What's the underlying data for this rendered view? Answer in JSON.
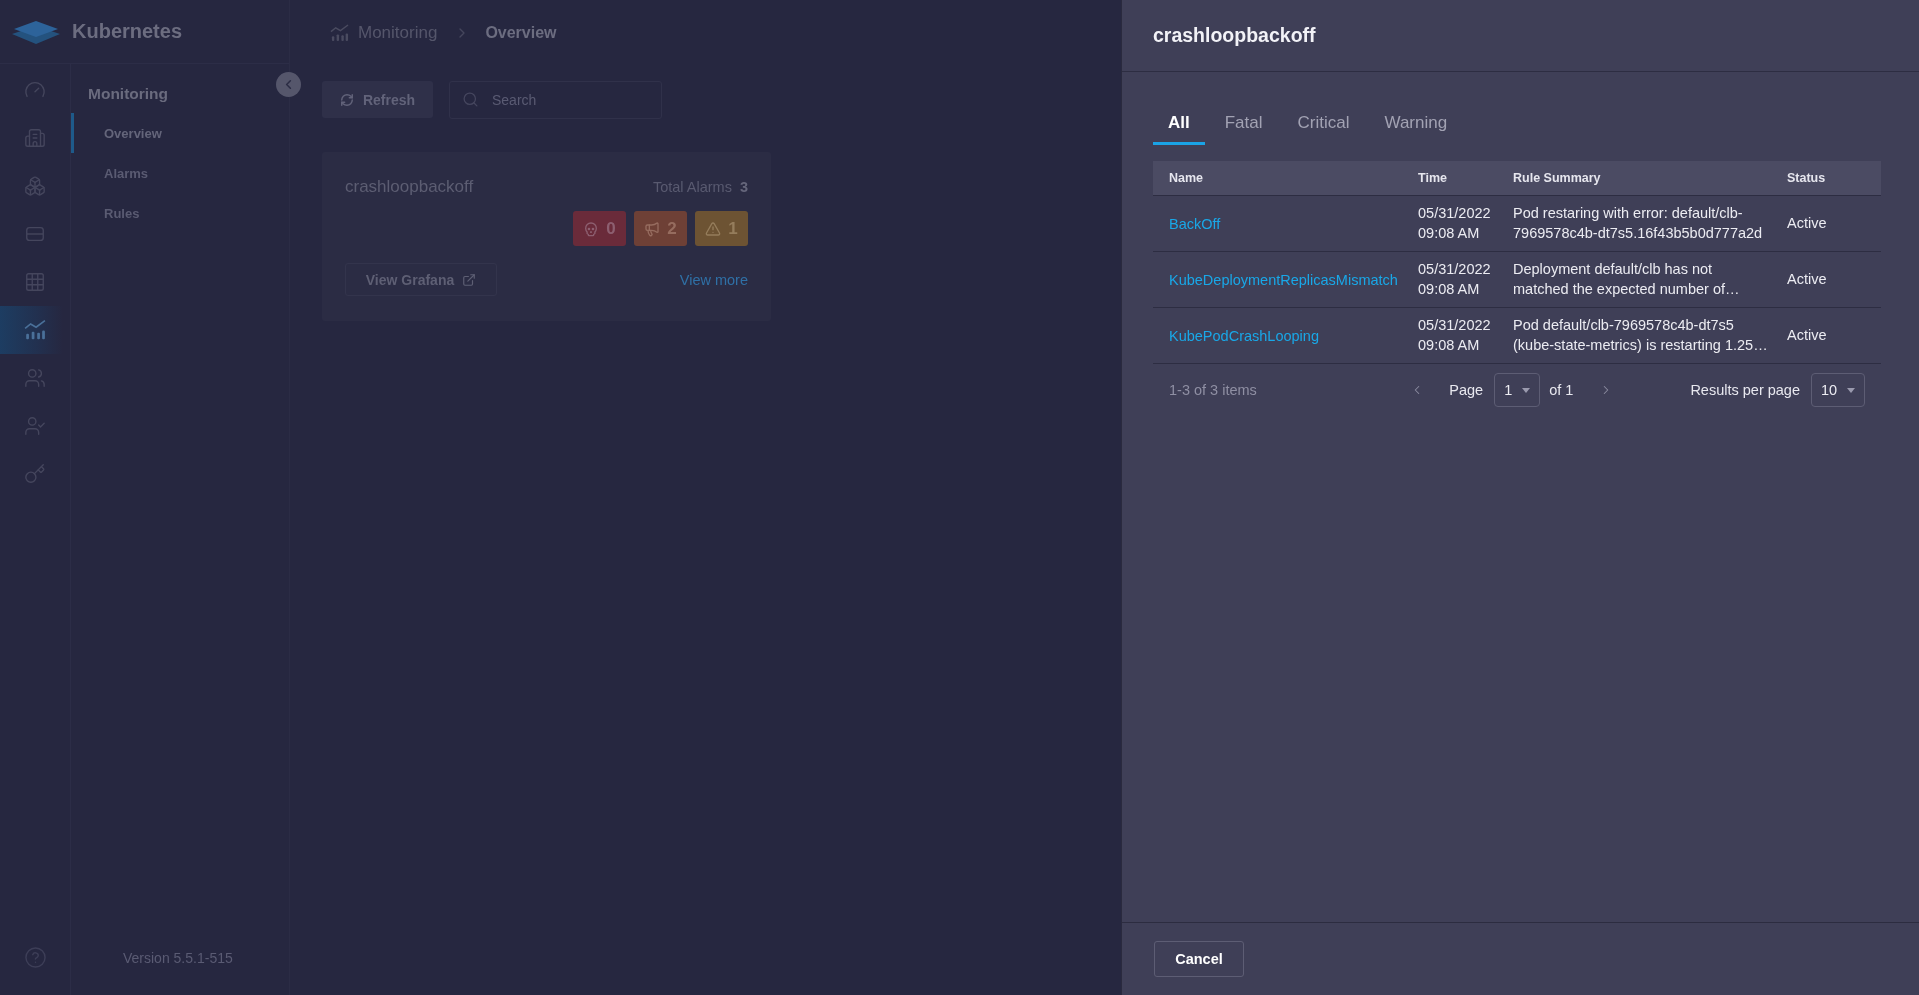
{
  "app": {
    "title": "Kubernetes"
  },
  "nav_rail": [
    {
      "selected": false
    },
    {
      "selected": false
    },
    {
      "selected": false
    },
    {
      "selected": false
    },
    {
      "selected": false
    },
    {
      "selected": true
    },
    {
      "selected": false
    },
    {
      "selected": false
    },
    {
      "selected": false
    }
  ],
  "sidebar": {
    "title": "Monitoring",
    "items": [
      {
        "label": "Overview",
        "selected": true
      },
      {
        "label": "Alarms",
        "selected": false
      },
      {
        "label": "Rules",
        "selected": false
      }
    ],
    "version": "Version 5.5.1-515"
  },
  "breadcrumb": {
    "parent": "Monitoring",
    "current": "Overview"
  },
  "toolbar": {
    "refresh_button": "Refresh",
    "search": {
      "placeholder": "Search"
    }
  },
  "alarm_card": {
    "title": "crashloopbackoff",
    "total_label": "Total Alarms",
    "total": "3",
    "badges": [
      {
        "kind": "fatal",
        "count": "0"
      },
      {
        "kind": "critical",
        "count": "2"
      },
      {
        "kind": "warning",
        "count": "1"
      }
    ],
    "grafana_button": "View Grafana",
    "view_more_link": "View more"
  },
  "drawer": {
    "title": "crashloopbackoff",
    "tabs": [
      {
        "label": "All",
        "selected": true
      },
      {
        "label": "Fatal",
        "selected": false
      },
      {
        "label": "Critical",
        "selected": false
      },
      {
        "label": "Warning",
        "selected": false
      }
    ],
    "table": {
      "columns": [
        "Name",
        "Time",
        "Rule Summary",
        "Status"
      ],
      "rows": [
        {
          "name": "BackOff",
          "time": "05/31/2022 09:08 AM",
          "summary": "Pod restaring with error: default/clb-7969578c4b-dt7s5.16f43b5b0d777a2d",
          "status": "Active"
        },
        {
          "name": "KubeDeploymentReplicasMismatch",
          "time": "05/31/2022 09:08 AM",
          "summary": "Deployment default/clb has not matched the expected number of…",
          "status": "Active"
        },
        {
          "name": "KubePodCrashLooping",
          "time": "05/31/2022 09:08 AM",
          "summary": "Pod default/clb-7969578c4b-dt7s5 (kube-state-metrics) is restarting 1.25…",
          "status": "Active"
        }
      ]
    },
    "pagination": {
      "range": "1-3 of 3 items",
      "page_label": "Page",
      "page": "1",
      "of_pages": "of 1",
      "per_page_label": "Results per page",
      "per_page": "10"
    },
    "cancel_button": "Cancel"
  }
}
